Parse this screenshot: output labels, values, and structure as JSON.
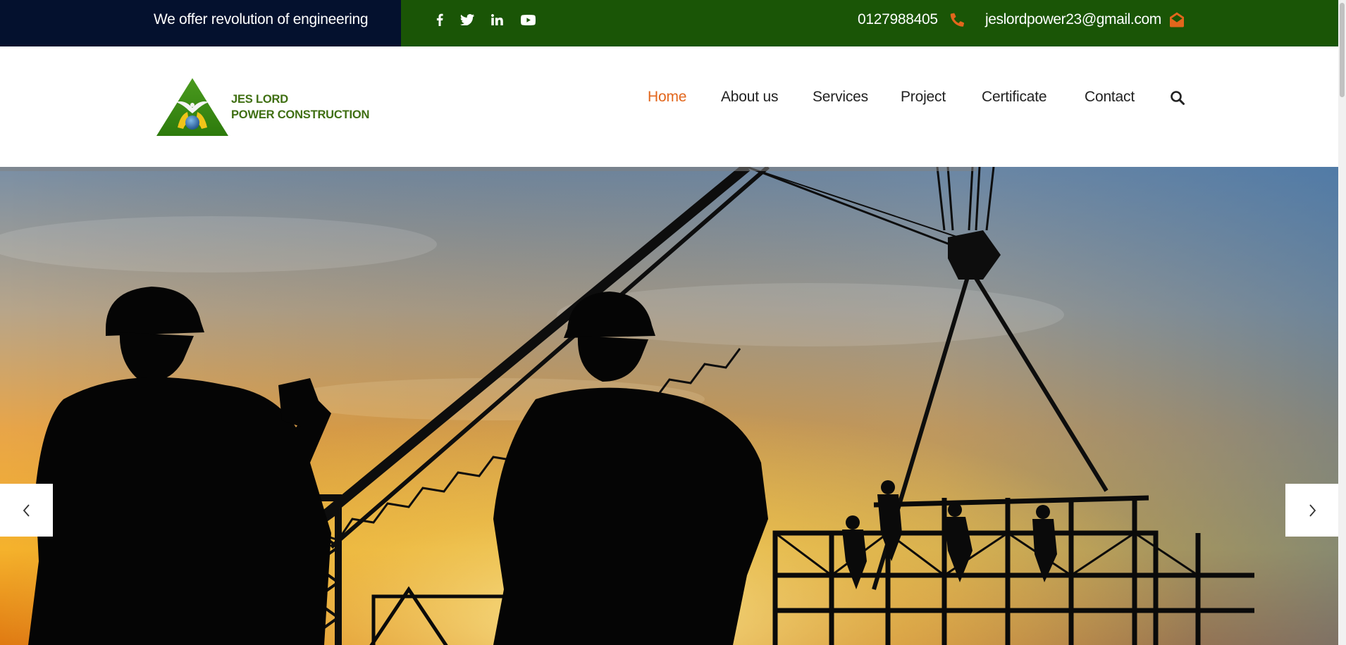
{
  "topbar": {
    "tagline": "We offer revolution of engineering",
    "social": [
      "facebook-icon",
      "twitter-icon",
      "linkedin-icon",
      "youtube-icon"
    ],
    "phone": "0127988405",
    "email": "jeslordpower23@gmail.com"
  },
  "logo": {
    "line1": "JES LORD",
    "line2": "POWER CONSTRUCTION"
  },
  "nav": {
    "items": [
      {
        "label": "Home",
        "active": true
      },
      {
        "label": "About us",
        "active": false
      },
      {
        "label": "Services",
        "active": false
      },
      {
        "label": "Project",
        "active": false
      },
      {
        "label": "Certificate",
        "active": false
      },
      {
        "label": "Contact",
        "active": false
      }
    ]
  },
  "hero": {
    "slide_progress": 0.73,
    "prev_icon": "chevron-left-icon",
    "next_icon": "chevron-right-icon"
  },
  "colors": {
    "topbar_green": "#1a5506",
    "tagline_navy": "#04112e",
    "accent_orange": "#e2661c",
    "logo_green": "#3f6f12"
  }
}
